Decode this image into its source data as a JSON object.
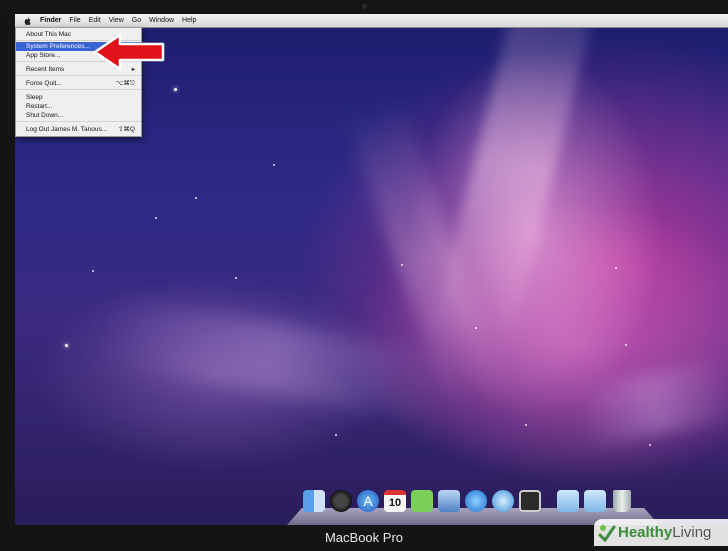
{
  "menubar": {
    "items": [
      "Finder",
      "File",
      "Edit",
      "View",
      "Go",
      "Window",
      "Help"
    ]
  },
  "apple_menu": {
    "items": [
      {
        "label": "About This Mac",
        "shortcut": ""
      },
      {
        "label": "System Preferences...",
        "shortcut": ""
      },
      {
        "label": "App Store...",
        "shortcut": ""
      },
      {
        "label": "Recent Items",
        "shortcut": "▸"
      },
      {
        "label": "Force Quit...",
        "shortcut": "⌥⌘⎋"
      },
      {
        "label": "Sleep",
        "shortcut": ""
      },
      {
        "label": "Restart...",
        "shortcut": ""
      },
      {
        "label": "Shut Down...",
        "shortcut": ""
      },
      {
        "label": "Log Out James M. Tanous...",
        "shortcut": "⇧⌘Q"
      }
    ],
    "highlighted_item": "System Preferences..."
  },
  "dock": {
    "icons": [
      "finder-icon",
      "dashboard-icon",
      "app-store-icon",
      "calendar-icon",
      "evernote-icon",
      "preview-icon",
      "itunes-icon",
      "safari-icon",
      "photo-booth-icon",
      "applications-folder-icon",
      "documents-folder-icon",
      "trash-icon"
    ],
    "calendar_day": "10"
  },
  "caption": "MacBook Pro",
  "watermark": {
    "brand": "Healthy",
    "brand2": "Living"
  },
  "colors": {
    "highlight": "#3a63d4",
    "arrow": "#e0121a",
    "watermark_green": "#3b8c3b"
  }
}
